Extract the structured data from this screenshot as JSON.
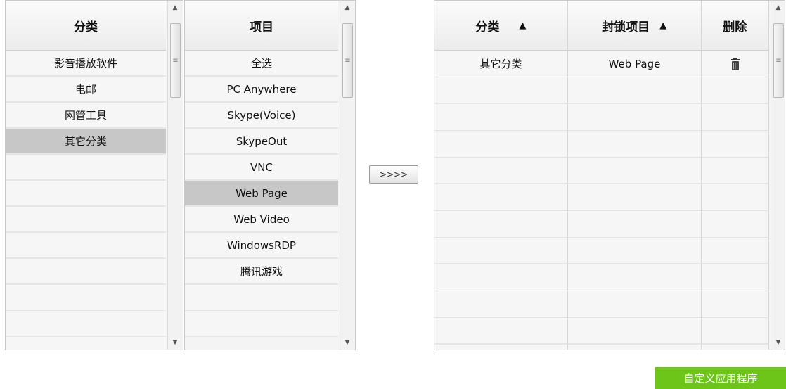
{
  "category_panel": {
    "header": "分类",
    "items": [
      "影音播放软件",
      "电邮",
      "网管工具",
      "其它分类",
      "",
      "",
      "",
      "",
      "",
      "",
      "",
      ""
    ],
    "selected_index": 3
  },
  "item_panel": {
    "header": "项目",
    "items": [
      "全选",
      "PC Anywhere",
      "Skype(Voice)",
      "SkypeOut",
      "VNC",
      "Web Page",
      "Web Video",
      "WindowsRDP",
      "腾讯游戏",
      "",
      ""
    ],
    "selected_index": 5
  },
  "transfer_button": {
    "label": ">>>>"
  },
  "blocked_table": {
    "headers": {
      "category": "分类",
      "item": "封锁项目",
      "delete": "删除"
    },
    "sort_glyph": "▲",
    "rows": [
      {
        "category": "其它分类",
        "item": "Web Page",
        "delete_icon": "trash-icon"
      }
    ],
    "empty_rows": 11
  },
  "custom_app_button": {
    "label": "自定义应用程序"
  },
  "scroll_glyphs": {
    "up": "▲",
    "down": "▼",
    "grip": "≡"
  },
  "colors": {
    "accent": "#6ec51a",
    "selected_row": "#c7c7c7"
  }
}
